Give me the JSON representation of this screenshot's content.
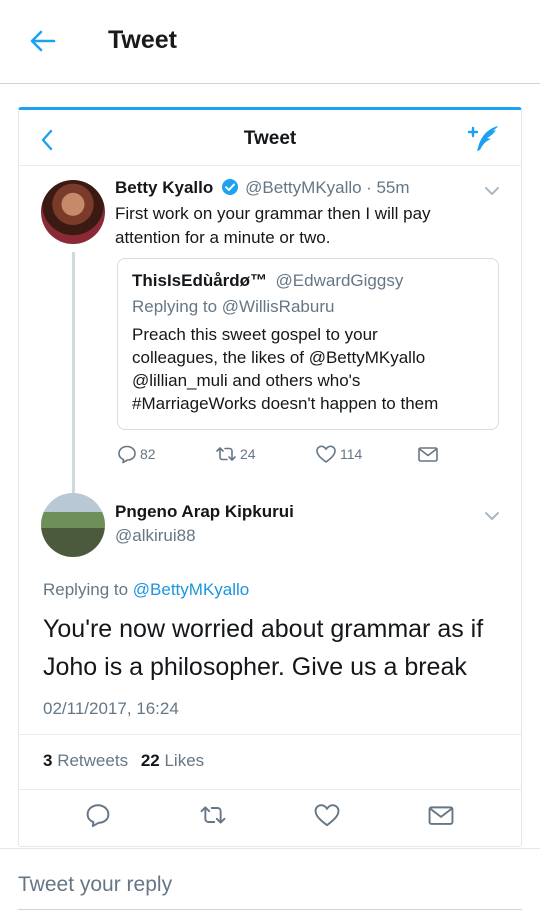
{
  "header": {
    "title": "Tweet",
    "icon": "back-arrow-icon",
    "accent": "#1da1f2"
  },
  "card": {
    "title": "Tweet"
  },
  "tweet": {
    "name": "Betty Kyallo",
    "handle": "@BettyMKyallo",
    "time": "· 55m",
    "text_line1": "First work on your grammar then I will pay",
    "text_line2": "attention for a minute or two.",
    "verified": true,
    "quote": {
      "name": "ThisIsEdùårdø™",
      "handle": "@EdwardGiggsy",
      "replying": "Replying to @WillisRaburu",
      "lines": [
        "Preach this sweet gospel to your",
        "colleagues, the likes of @BettyMKyallo",
        "@lillian_muli and others who's",
        "#MarriageWorks doesn't happen to them"
      ]
    },
    "replies": "82",
    "retweets": "24",
    "likes": "114"
  },
  "reply": {
    "name": "Pngeno Arap Kipkurui",
    "handle": "@alkirui88",
    "replying_prefix": "Replying to ",
    "replying_mention": "@BettyMKyallo",
    "text": "You're now worried about grammar as if Joho is a philosopher. Give us a break",
    "timestamp": "02/11/2017, 16:24",
    "retweet_count": "3",
    "retweet_label": "Retweets",
    "like_count": "22",
    "like_label": "Likes"
  },
  "reply_bar": {
    "placeholder": "Tweet your reply"
  }
}
